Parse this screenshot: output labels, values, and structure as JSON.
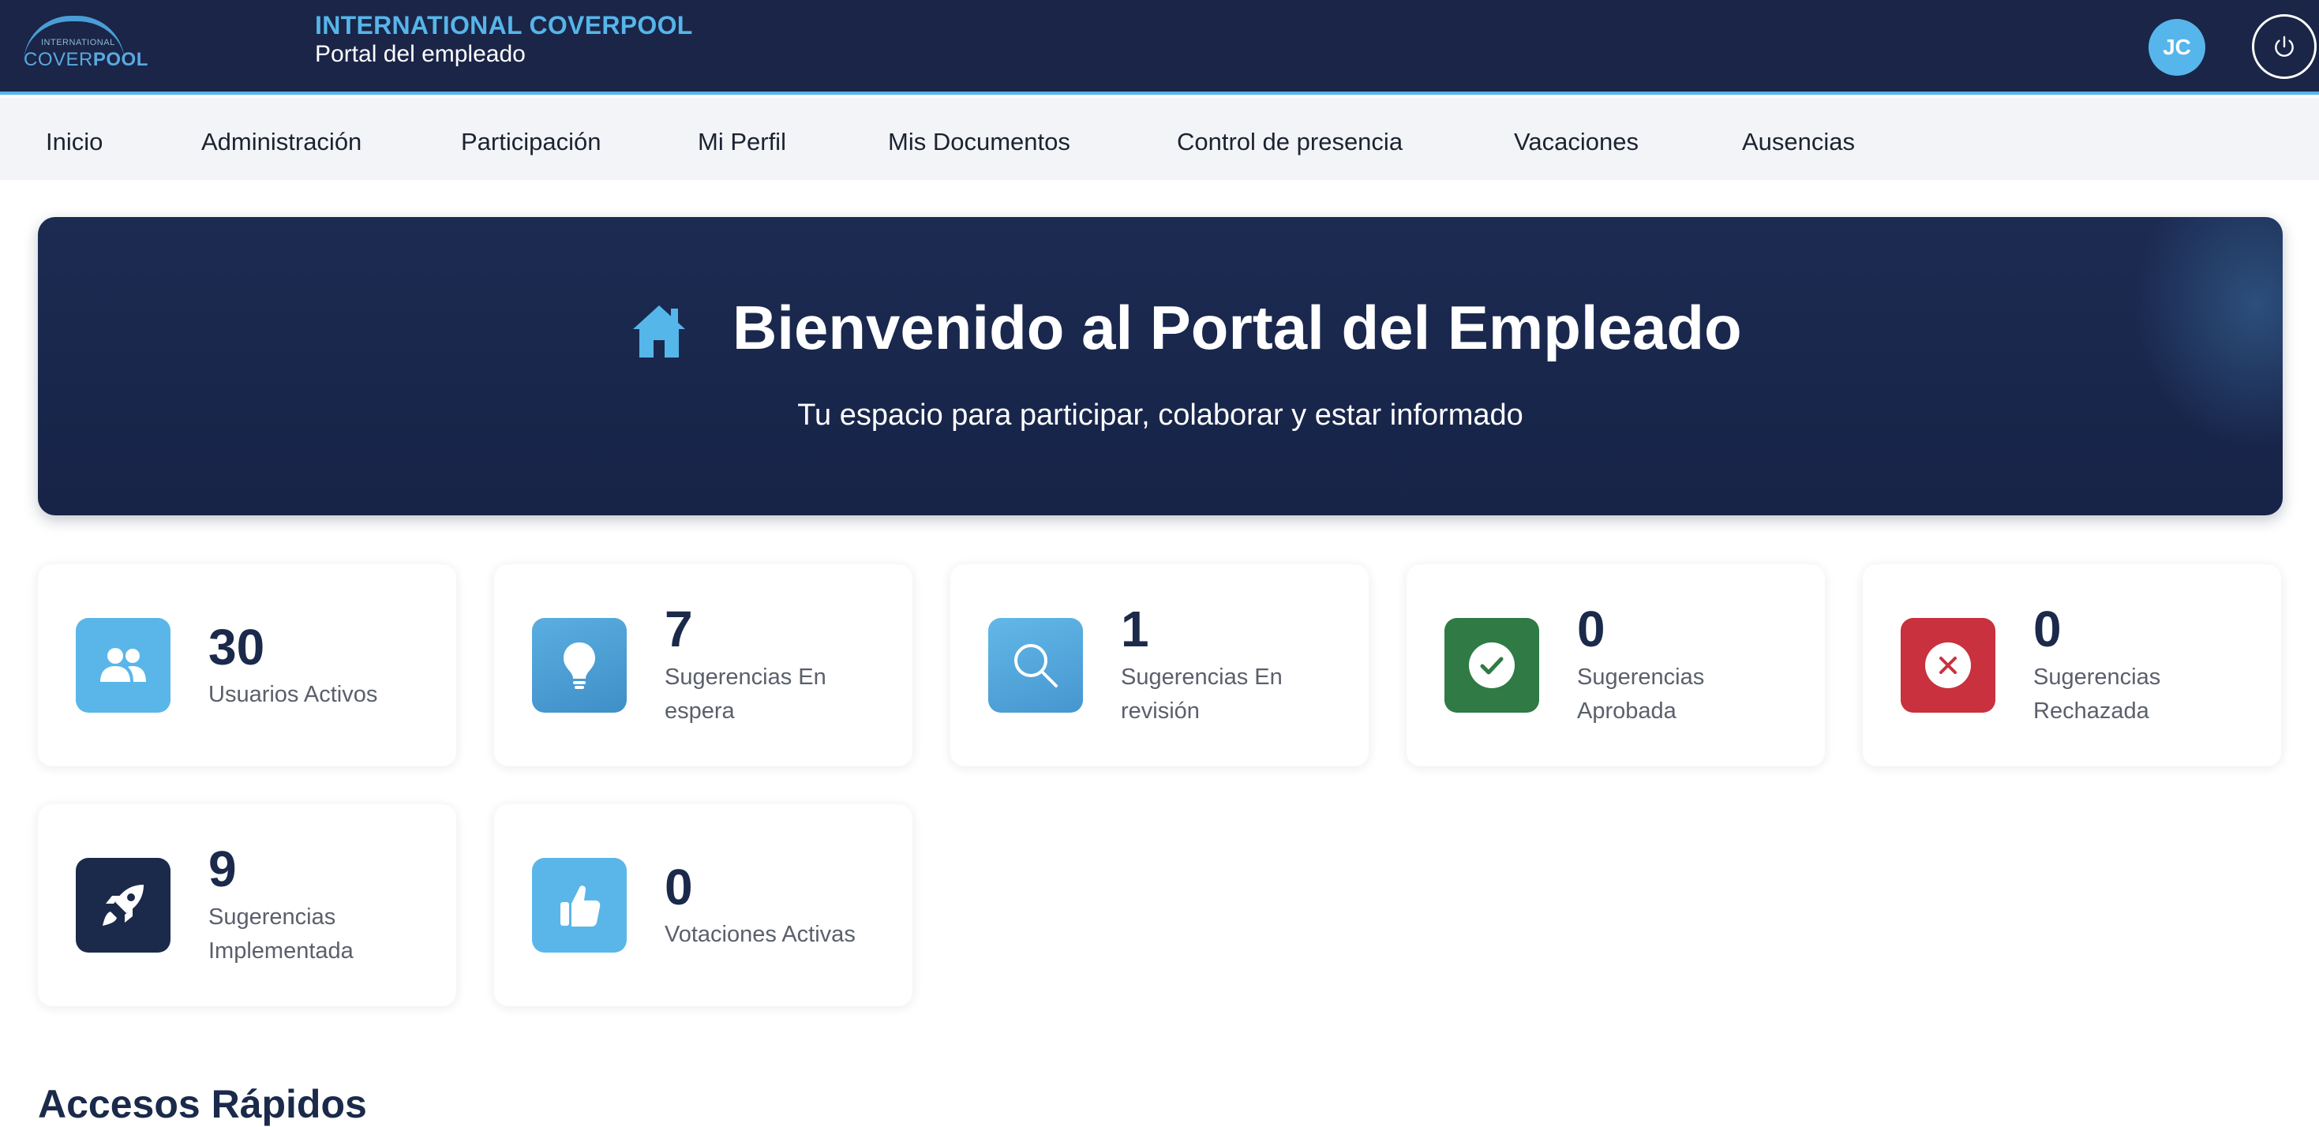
{
  "header": {
    "logo_small": "INTERNATIONAL",
    "logo_name_a": "COVER",
    "logo_name_b": "POOL",
    "company": "INTERNATIONAL COVERPOOL",
    "portal": "Portal del empleado",
    "avatar_initials": "JC",
    "power_icon": "power-icon"
  },
  "nav": {
    "items": [
      "Inicio",
      "Administración",
      "Participación",
      "Mi Perfil",
      "Mis Documentos",
      "Control de presencia",
      "Vacaciones",
      "Ausencias"
    ]
  },
  "hero": {
    "icon": "home-icon",
    "title": "Bienvenido al Portal del Empleado",
    "subtitle": "Tu espacio para participar, colaborar y estar informado"
  },
  "stats": [
    {
      "value": "30",
      "label": "Usuarios Activos",
      "icon": "users-icon",
      "color": "#5ab6e8"
    },
    {
      "value": "7",
      "label": "Sugerencias En espera",
      "icon": "lightbulb-icon",
      "color": "#4a9fd6"
    },
    {
      "value": "1",
      "label": "Sugerencias En revisión",
      "icon": "search-icon",
      "color": "#55ace0"
    },
    {
      "value": "0",
      "label": "Sugerencias Aprobada",
      "icon": "check-circle-icon",
      "color": "#2f7a45"
    },
    {
      "value": "0",
      "label": "Sugerencias Rechazada",
      "icon": "x-circle-icon",
      "color": "#c8313d"
    },
    {
      "value": "9",
      "label": "Sugerencias Implementada",
      "icon": "rocket-icon",
      "color": "#1b2a4a"
    },
    {
      "value": "0",
      "label": "Votaciones Activas",
      "icon": "thumbs-up-icon",
      "color": "#5ab6e8"
    }
  ],
  "quick_access": {
    "title": "Accesos Rápidos"
  }
}
